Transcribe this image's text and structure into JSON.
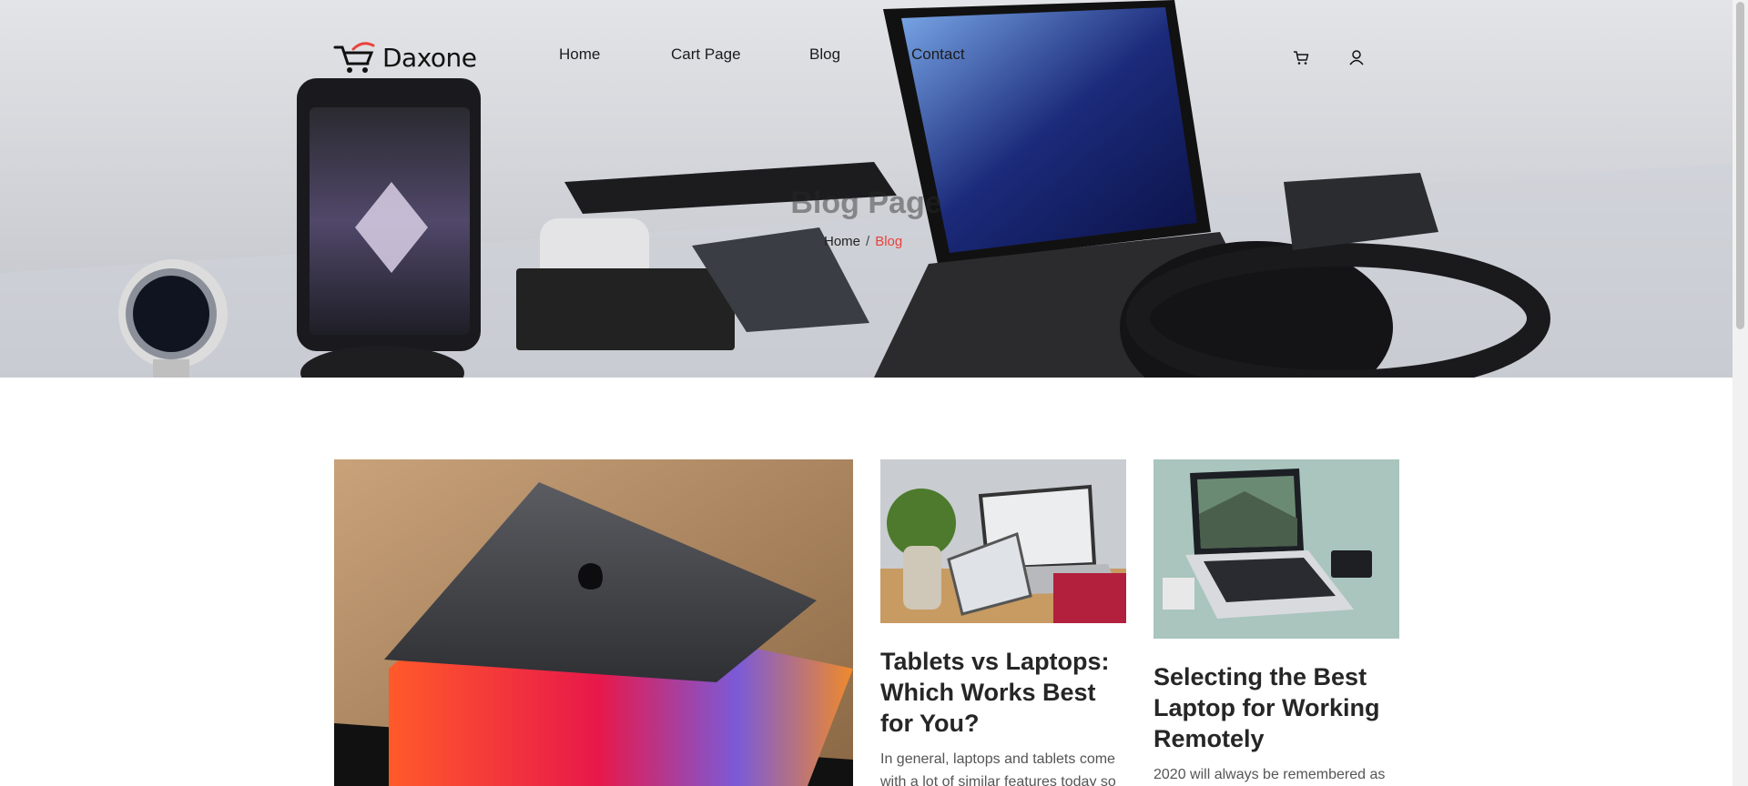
{
  "brand": {
    "name": "Daxone",
    "accent": "#e8423b"
  },
  "nav": {
    "items": [
      {
        "label": "Home"
      },
      {
        "label": "Cart Page"
      },
      {
        "label": "Blog"
      },
      {
        "label": "Contact"
      }
    ]
  },
  "header_icons": {
    "cart": "cart-icon",
    "user": "user-icon"
  },
  "hero": {
    "title": "Blog Page",
    "breadcrumb": {
      "home": "Home",
      "separator": "/",
      "current": "Blog"
    }
  },
  "posts": [
    {
      "image": "macbook-photo",
      "title": "",
      "excerpt": ""
    },
    {
      "image": "tablet-and-laptop-photo",
      "title": "Tablets vs Laptops: Which Works Best for You?",
      "excerpt": "In general, laptops and tablets come with a lot of similar features today so"
    },
    {
      "image": "laptop-on-desk-photo",
      "title": "Selecting the Best Laptop for Working Remotely",
      "excerpt": "2020 will always be remembered as"
    }
  ]
}
